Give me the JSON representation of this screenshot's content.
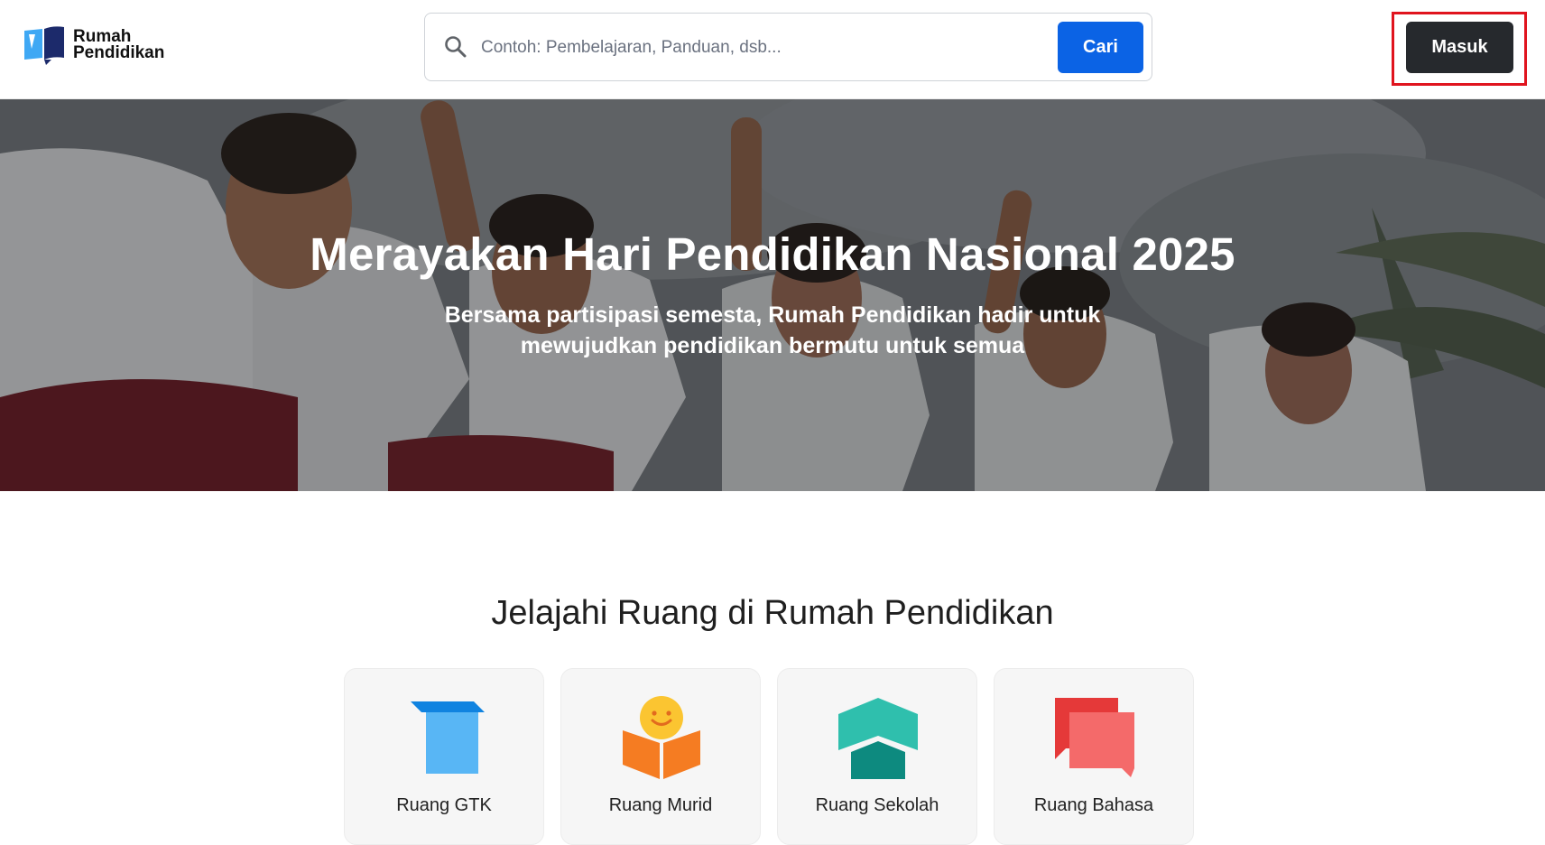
{
  "header": {
    "logo": {
      "line1": "Rumah",
      "line2": "Pendidikan"
    },
    "search": {
      "placeholder": "Contoh: Pembelajaran, Panduan, dsb...",
      "button_label": "Cari"
    },
    "login_label": "Masuk"
  },
  "hero": {
    "title": "Merayakan Hari Pendidikan Nasional 2025",
    "subtitle": "Bersama partisipasi semesta, Rumah Pendidikan hadir untuk mewujudkan pendidikan bermutu untuk semua"
  },
  "explore": {
    "title": "Jelajahi Ruang di Rumah Pendidikan",
    "cards": [
      {
        "label": "Ruang GTK",
        "icon": "gtk-box-icon"
      },
      {
        "label": "Ruang Murid",
        "icon": "murid-book-icon"
      },
      {
        "label": "Ruang Sekolah",
        "icon": "sekolah-building-icon"
      },
      {
        "label": "Ruang Bahasa",
        "icon": "bahasa-chat-icon"
      }
    ]
  },
  "colors": {
    "primary_blue": "#0b63e5",
    "dark_button": "#26292d",
    "highlight_red": "#e0141e"
  }
}
